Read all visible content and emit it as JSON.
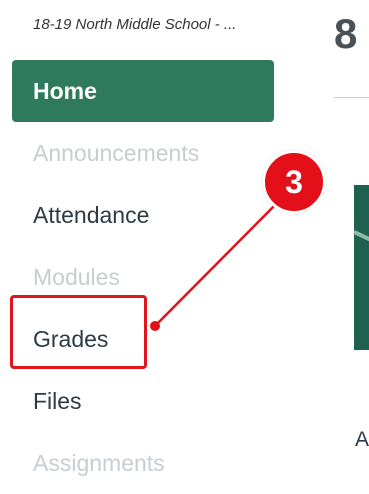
{
  "course": {
    "title": "18-19 North Middle School - ..."
  },
  "nav": {
    "items": [
      {
        "label": "Home",
        "state": "active"
      },
      {
        "label": "Announcements",
        "state": "disabled"
      },
      {
        "label": "Attendance",
        "state": "normal"
      },
      {
        "label": "Modules",
        "state": "disabled"
      },
      {
        "label": "Grades",
        "state": "normal"
      },
      {
        "label": "Files",
        "state": "normal"
      },
      {
        "label": "Assignments",
        "state": "disabled"
      }
    ]
  },
  "main": {
    "page_number": "8",
    "content_letter": "A"
  },
  "annotation": {
    "step_number": "3",
    "color": "#e3101a"
  },
  "colors": {
    "accent": "#2f7a5c",
    "text": "#2d3b45",
    "disabled_text": "#c7cdd1"
  }
}
